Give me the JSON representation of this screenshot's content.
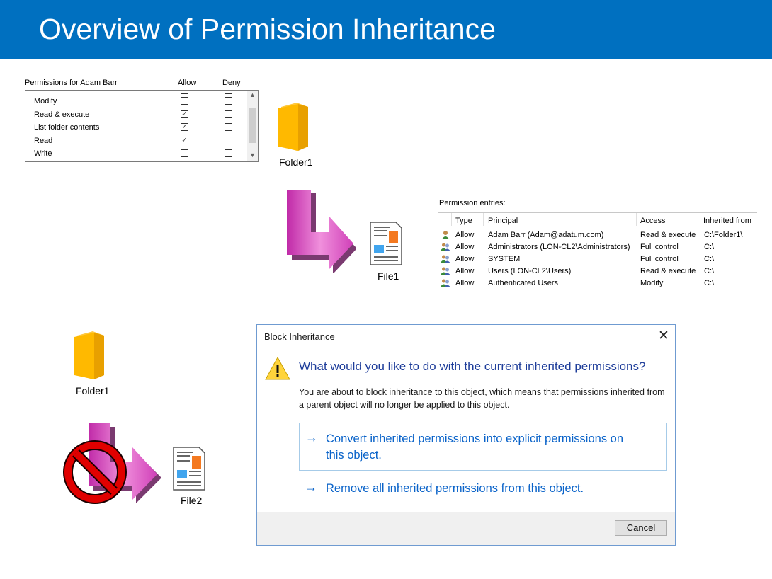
{
  "slide": {
    "title": "Overview of Permission Inheritance"
  },
  "permissions_panel": {
    "header_label": "Permissions for Adam Barr",
    "allow_header": "Allow",
    "deny_header": "Deny",
    "rows": [
      {
        "name": "Modify",
        "allow": false,
        "deny": false
      },
      {
        "name": "Read & execute",
        "allow": true,
        "deny": false
      },
      {
        "name": "List folder contents",
        "allow": true,
        "deny": false
      },
      {
        "name": "Read",
        "allow": true,
        "deny": false
      },
      {
        "name": "Write",
        "allow": false,
        "deny": false
      }
    ]
  },
  "top_diagram": {
    "folder_label": "Folder1",
    "file_label": "File1"
  },
  "permission_entries": {
    "title": "Permission entries:",
    "columns": [
      "Type",
      "Principal",
      "Access",
      "Inherited from"
    ],
    "rows": [
      {
        "type": "Allow",
        "principal": "Adam Barr (Adam@adatum.com)",
        "access": "Read & execute",
        "inherited_from": "C:\\Folder1\\",
        "icon": "single-user-icon"
      },
      {
        "type": "Allow",
        "principal": "Administrators (LON-CL2\\Administrators)",
        "access": "Full control",
        "inherited_from": "C:\\",
        "icon": "group-users-icon"
      },
      {
        "type": "Allow",
        "principal": "SYSTEM",
        "access": "Full control",
        "inherited_from": "C:\\",
        "icon": "group-users-icon"
      },
      {
        "type": "Allow",
        "principal": "Users (LON-CL2\\Users)",
        "access": "Read & execute",
        "inherited_from": "C:\\",
        "icon": "group-users-icon"
      },
      {
        "type": "Allow",
        "principal": "Authenticated Users",
        "access": "Modify",
        "inherited_from": "C:\\",
        "icon": "group-users-icon"
      }
    ]
  },
  "bottom_diagram": {
    "folder_label": "Folder1",
    "file_label": "File2"
  },
  "dialog": {
    "title": "Block Inheritance",
    "heading": "What would you like to do with the current inherited permissions?",
    "description": "You are about to block inheritance to this object, which means that permissions inherited from a parent object will no longer be applied to this object.",
    "option1_line1": "Convert inherited permissions into explicit permissions on",
    "option1_line2": "this object.",
    "option2": "Remove all inherited permissions from this object.",
    "cancel_label": "Cancel",
    "arrow_glyph": "→",
    "close_glyph": "✕"
  },
  "colors": {
    "title_bar": "#0070c0",
    "folder": "#ffb900",
    "arrow_magenta": "#e04ec8",
    "link_blue": "#0a63c9",
    "no_sign_red": "#e00000"
  }
}
